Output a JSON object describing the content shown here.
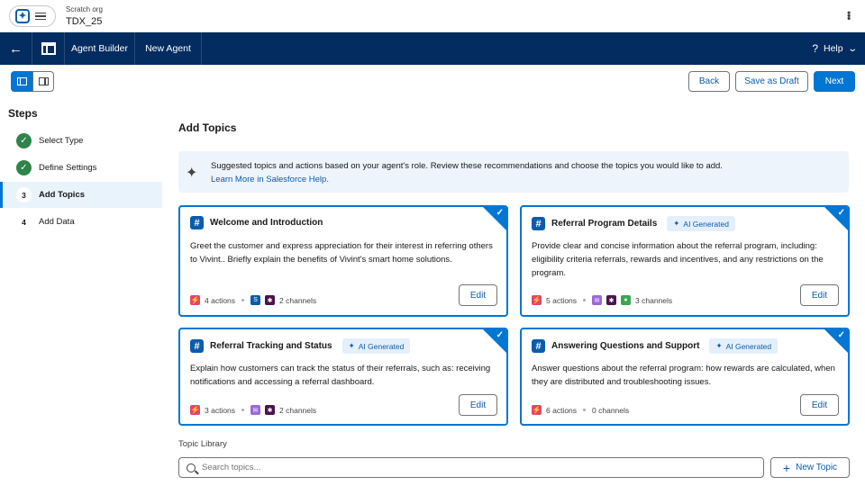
{
  "header": {
    "org_sub": "Scratch org",
    "org_name": "TDX_25"
  },
  "nav": {
    "app_name": "Agent Builder",
    "tab": "New Agent",
    "help": "Help"
  },
  "toolbar": {
    "back": "Back",
    "save_draft": "Save as Draft",
    "next": "Next"
  },
  "steps": {
    "title": "Steps",
    "items": [
      {
        "label": "Select Type",
        "status": "complete",
        "num": "1"
      },
      {
        "label": "Define Settings",
        "status": "complete",
        "num": "2"
      },
      {
        "label": "Add Topics",
        "status": "active",
        "num": "3"
      },
      {
        "label": "Add Data",
        "status": "pending",
        "num": "4"
      }
    ]
  },
  "main": {
    "title": "Add Topics",
    "banner_text": "Suggested topics and actions based on your agent's role. Review these recommendations and choose the topics you would like to add.",
    "banner_link": "Learn More in Salesforce Help.",
    "ai_badge": "AI Generated",
    "edit_label": "Edit",
    "cards": [
      {
        "title": "Welcome and Introduction",
        "body": "Greet the customer and express appreciation for their interest in referring others to Vivint.. Briefly explain the benefits of Vivint's smart home solutions.",
        "actions": "4 actions",
        "channels": "2 channels"
      },
      {
        "title": "Referral Program Details",
        "body": "Provide clear and concise information about the referral program, including: eligibility criteria referrals, rewards and incentives, and any restrictions on the program.",
        "actions": "5 actions",
        "channels": "3 channels"
      },
      {
        "title": "Referral Tracking and Status",
        "body": "Explain how customers can track the status of their referrals, such as: receiving notifications and accessing a referral dashboard.",
        "actions": "3 actions",
        "channels": "2 channels"
      },
      {
        "title": "Answering Questions and Support",
        "body": "Answer questions about the referral program: how rewards are calculated, when they are distributed and troubleshooting issues.",
        "actions": "6 actions",
        "channels": "0 channels"
      }
    ],
    "library_title": "Topic Library",
    "search_placeholder": "Search topics...",
    "new_topic": "New Topic"
  },
  "colors": {
    "brand_blue": "#0176d3",
    "nav_bg": "#032d60",
    "success": "#2e844a"
  }
}
